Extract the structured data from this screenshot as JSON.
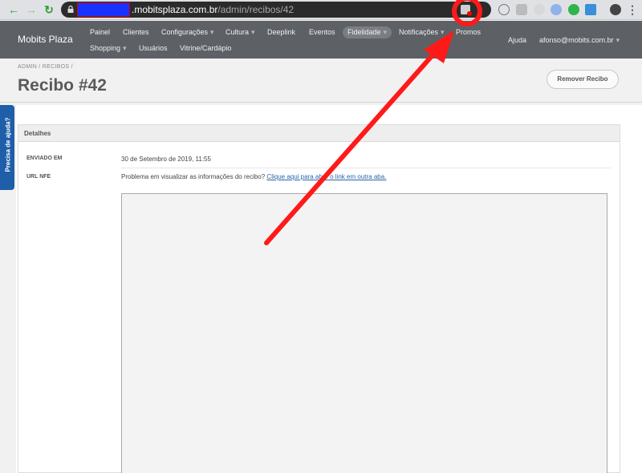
{
  "browser": {
    "url_host": ".mobitsplaza.com.br",
    "url_path": "/admin/recibos/42"
  },
  "app": {
    "brand": "Mobits Plaza",
    "nav_row1": [
      "Painel",
      "Clientes",
      "Configurações",
      "Cultura",
      "Deeplink",
      "Eventos",
      "Fidelidade",
      "Notificações",
      "Promos"
    ],
    "nav_row2": [
      "Shopping",
      "Usuários",
      "Vitrine/Cardápio"
    ],
    "help": "Ajuda",
    "user_email": "afonso@mobits.com.br"
  },
  "page": {
    "breadcrumb": "ADMIN  /  RECIBOS  /",
    "title": "Recibo #42",
    "remove_button": "Remover Recibo"
  },
  "help_tab": "Precisa de ajuda?",
  "details": {
    "panel_title": "Detalhes",
    "sent_label": "ENVIADO EM",
    "sent_value": "30 de Setembro de 2019, 11:55",
    "nfe_label": "URL NFE",
    "nfe_text": "Problema em visualizar as informações do recibo? ",
    "nfe_link": "Clique aqui para abrir o link em outra aba."
  },
  "colors": {
    "header_bg": "#5d6165",
    "help_tab_bg": "#1f5ea8",
    "annotation": "#ff1a1a"
  }
}
